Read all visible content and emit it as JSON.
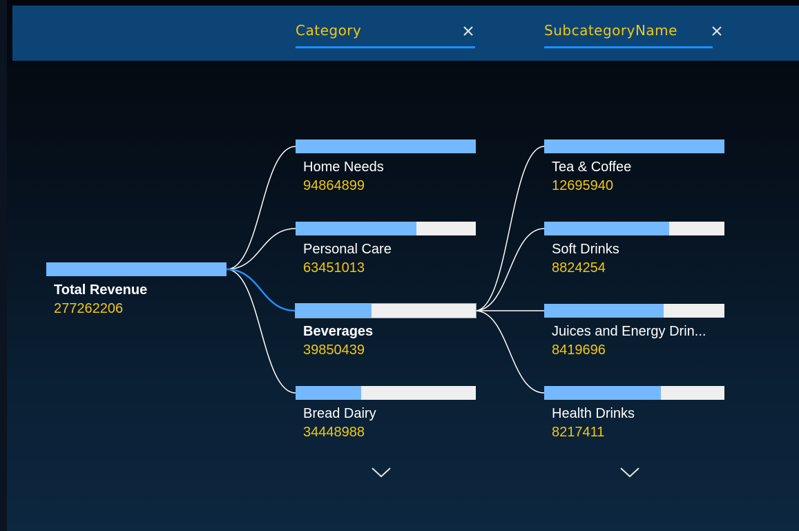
{
  "levels": [
    {
      "title": "Category",
      "close_icon": "close-icon"
    },
    {
      "title": "SubcategoryName",
      "close_icon": "close-icon"
    }
  ],
  "root": {
    "label": "Total Revenue",
    "value": "277262206"
  },
  "categories": [
    {
      "label": "Home Needs",
      "value": "94864899",
      "share": 1.0
    },
    {
      "label": "Personal Care",
      "value": "63451013",
      "share": 0.669
    },
    {
      "label": "Beverages",
      "value": "39850439",
      "share": 0.42,
      "selected": true
    },
    {
      "label": "Bread Dairy",
      "value": "34448988",
      "share": 0.363
    }
  ],
  "subcategories": [
    {
      "label": "Tea & Coffee",
      "value": "12695940",
      "share": 1.0
    },
    {
      "label": "Soft Drinks",
      "value": "8824254",
      "share": 0.695
    },
    {
      "label": "Juices and Energy Drin...",
      "value": "8419696",
      "share": 0.663
    },
    {
      "label": "Health Drinks",
      "value": "8217411",
      "share": 0.647
    }
  ],
  "scroll_icons": [
    "chevron-down-icon",
    "chevron-down-icon"
  ],
  "colors": {
    "header_bg": "#0d4476",
    "level_title": "#f2c811",
    "underline": "#1e90ff",
    "bar_fill": "#74b9ff",
    "bar_track": "#efefef",
    "value_text": "#f2c811",
    "connector": "#ffffff",
    "selected_connector": "#1e90ff"
  }
}
